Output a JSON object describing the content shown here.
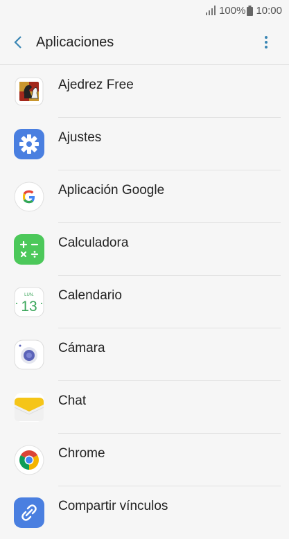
{
  "status_bar": {
    "battery_percent": "100%",
    "time": "10:00"
  },
  "header": {
    "title": "Aplicaciones"
  },
  "apps": [
    {
      "label": "Ajedrez Free",
      "icon": "chess-icon"
    },
    {
      "label": "Ajustes",
      "icon": "settings-gear-icon"
    },
    {
      "label": "Aplicación Google",
      "icon": "google-icon"
    },
    {
      "label": "Calculadora",
      "icon": "calculator-icon"
    },
    {
      "label": "Calendario",
      "icon": "calendar-icon",
      "calendar_month": "LUN.",
      "calendar_day": "13"
    },
    {
      "label": "Cámara",
      "icon": "camera-icon"
    },
    {
      "label": "Chat",
      "icon": "chat-envelope-icon"
    },
    {
      "label": "Chrome",
      "icon": "chrome-icon"
    },
    {
      "label": "Compartir vínculos",
      "icon": "share-link-icon"
    }
  ],
  "colors": {
    "accent": "#3a86b4",
    "settings": "#4a7fe0",
    "calculator": "#4cc85a",
    "calendar_green": "#3aa65a",
    "chat_yellow": "#f5c518"
  }
}
